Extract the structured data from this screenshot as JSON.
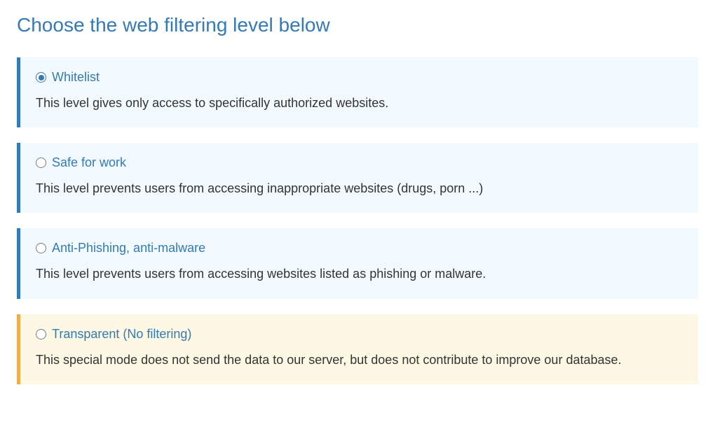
{
  "heading": "Choose the web filtering level below",
  "options": [
    {
      "id": "whitelist",
      "title": "Whitelist",
      "description": "This level gives only access to specifically authorized websites.",
      "selected": true,
      "variant": "info"
    },
    {
      "id": "safe-for-work",
      "title": "Safe for work",
      "description": "This level prevents users from accessing inappropriate websites (drugs, porn ...)",
      "selected": false,
      "variant": "info"
    },
    {
      "id": "anti-phishing",
      "title": "Anti-Phishing, anti-malware",
      "description": "This level prevents users from accessing websites listed as phishing or malware.",
      "selected": false,
      "variant": "info"
    },
    {
      "id": "transparent",
      "title": "Transparent (No filtering)",
      "description": "This special mode does not send the data to our server, but does not contribute to improve our database.",
      "selected": false,
      "variant": "warn"
    }
  ]
}
